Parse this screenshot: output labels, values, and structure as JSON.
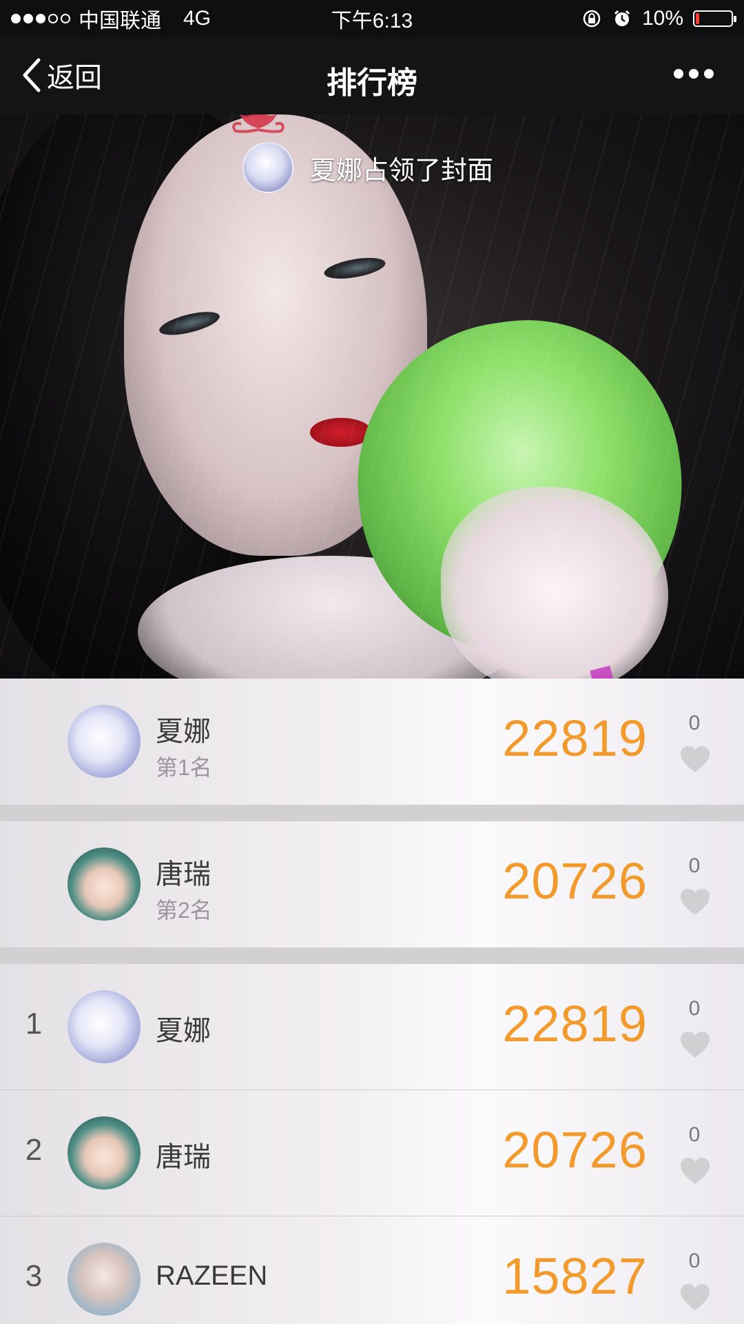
{
  "status_bar": {
    "carrier": "中国联通",
    "network": "4G",
    "time": "下午6:13",
    "battery": "10%",
    "battery_level": 0.1,
    "signal_bars_filled": 3,
    "signal_bars_total": 5
  },
  "nav": {
    "back_label": "返回",
    "title": "排行榜"
  },
  "cover": {
    "owner_text": "夏娜占领了封面"
  },
  "top_rankings": [
    {
      "name": "夏娜",
      "rank_label": "第1名",
      "score": "22819",
      "likes": "0"
    },
    {
      "name": "唐瑞",
      "rank_label": "第2名",
      "score": "20726",
      "likes": "0"
    }
  ],
  "leaderboard": [
    {
      "rank": "1",
      "name": "夏娜",
      "score": "22819",
      "likes": "0"
    },
    {
      "rank": "2",
      "name": "唐瑞",
      "score": "20726",
      "likes": "0"
    },
    {
      "rank": "3",
      "name": "RAZEEN",
      "score": "15827",
      "likes": "0"
    }
  ],
  "colors": {
    "score": "#f39a2c",
    "nav_bg": "#141417",
    "battery_low": "#ff3b30"
  }
}
